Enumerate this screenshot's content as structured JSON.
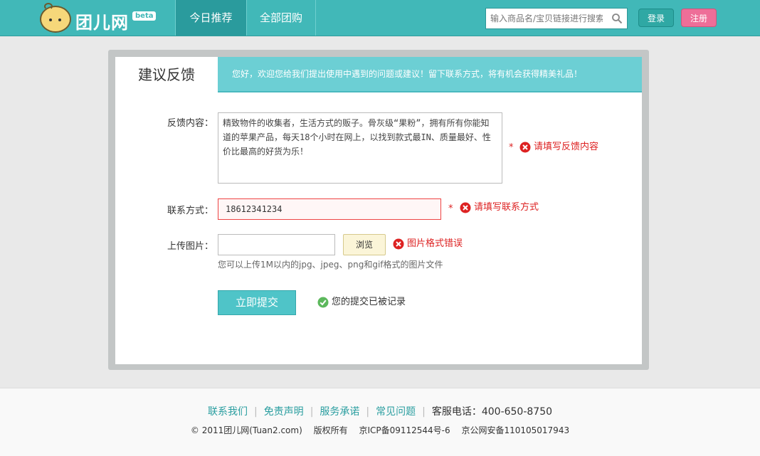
{
  "header": {
    "logo_text": "团儿网",
    "logo_badge": "beta",
    "nav": [
      {
        "label": "今日推荐",
        "active": true
      },
      {
        "label": "全部团购",
        "active": false
      }
    ],
    "search_placeholder": "输入商品名/宝贝链接进行搜索",
    "login_label": "登录",
    "register_label": "注册"
  },
  "card": {
    "title": "建议反馈",
    "notice": "您好，欢迎您给我们提出使用中遇到的问题或建议！留下联系方式，将有机会获得精美礼品！"
  },
  "form": {
    "feedback": {
      "label": "反馈内容：",
      "value": "精致物件的收集者，生活方式的贩子。骨灰级“果粉”，拥有所有你能知道的苹果产品，每天18个小时在网上，以找到款式最IN、质量最好、性价比最高的好货为乐！",
      "required_mark": "*",
      "error": "请填写反馈内容"
    },
    "contact": {
      "label": "联系方式：",
      "value": "18612341234",
      "required_mark": "*",
      "error": "请填写联系方式"
    },
    "image": {
      "label": "上传图片：",
      "browse_label": "浏览",
      "error": "图片格式错误",
      "hint": "您可以上传1M以内的jpg、jpeg、png和gif格式的图片文件"
    },
    "submit_label": "立即提交",
    "success": "您的提交已被记录"
  },
  "footer": {
    "links": [
      "联系我们",
      "免责声明",
      "服务承诺",
      "常见问题"
    ],
    "phone": "客服电话：400-650-8750",
    "copyright": "© 2011团儿网(Tuan2.com)",
    "rights": "版权所有",
    "icp": "京ICP备09112544号-6",
    "police": "京公网安备110105017943"
  },
  "colors": {
    "header_bg": "#41b8b8",
    "accent": "#4fc4c8",
    "error": "#dd2222",
    "register": "#ee6e98"
  }
}
